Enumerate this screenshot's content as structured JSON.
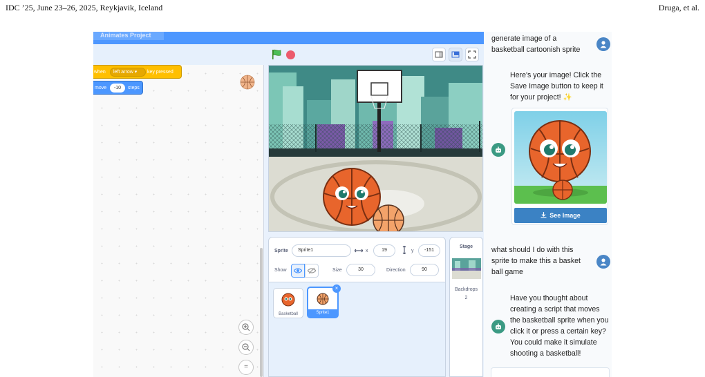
{
  "page_header": {
    "left": "IDC ’25, June 23–26, 2025, Reykjavik, Iceland",
    "right": "Druga, et al."
  },
  "scratch": {
    "project_tab": "Animates Project",
    "code": {
      "when_label": "when",
      "key": "left arrow",
      "key_pressed": "key pressed",
      "move_label": "move",
      "move_value": "-10",
      "steps_label": "steps"
    },
    "zoom_in": "+",
    "zoom_out": "−",
    "zoom_reset": "="
  },
  "sprite_info": {
    "sprite_label": "Sprite",
    "sprite_name": "Sprite1",
    "x_label": "x",
    "x_value": "19",
    "y_label": "y",
    "y_value": "-151",
    "show_label": "Show",
    "size_label": "Size",
    "size_value": "30",
    "direction_label": "Direction",
    "direction_value": "90"
  },
  "sprites": [
    {
      "name": "Basketball",
      "selected": false
    },
    {
      "name": "Sprite1",
      "selected": true
    }
  ],
  "stage_panel": {
    "title": "Stage",
    "backdrops_label": "Backdrops",
    "backdrops_count": "2"
  },
  "chat": {
    "messages": [
      {
        "role": "user",
        "text": [
          "generate image of a",
          "basketball cartoonish sprite"
        ]
      },
      {
        "role": "assistant",
        "text": [
          "Here's your image! Click the",
          "Save Image button to keep it",
          "for your project! ✨"
        ]
      },
      {
        "role": "user",
        "text": [
          "what should I do with this",
          "sprite to make this a basket",
          "ball game"
        ]
      },
      {
        "role": "assistant",
        "text": [
          "Have you thought about",
          "creating a script that moves",
          "the basketball sprite when you",
          "click it or press a certain key?",
          "You could make it simulate",
          "shooting a basketball!"
        ]
      }
    ],
    "see_image_button": "See Image"
  },
  "colors": {
    "scratch_blue": "#4d97ff",
    "events_yellow": "#ffbf00",
    "motion_blue": "#4c97ff",
    "user_avatar": "#4a86c6",
    "bot_avatar": "#3b9a83",
    "see_image_button": "#3b82c4"
  }
}
